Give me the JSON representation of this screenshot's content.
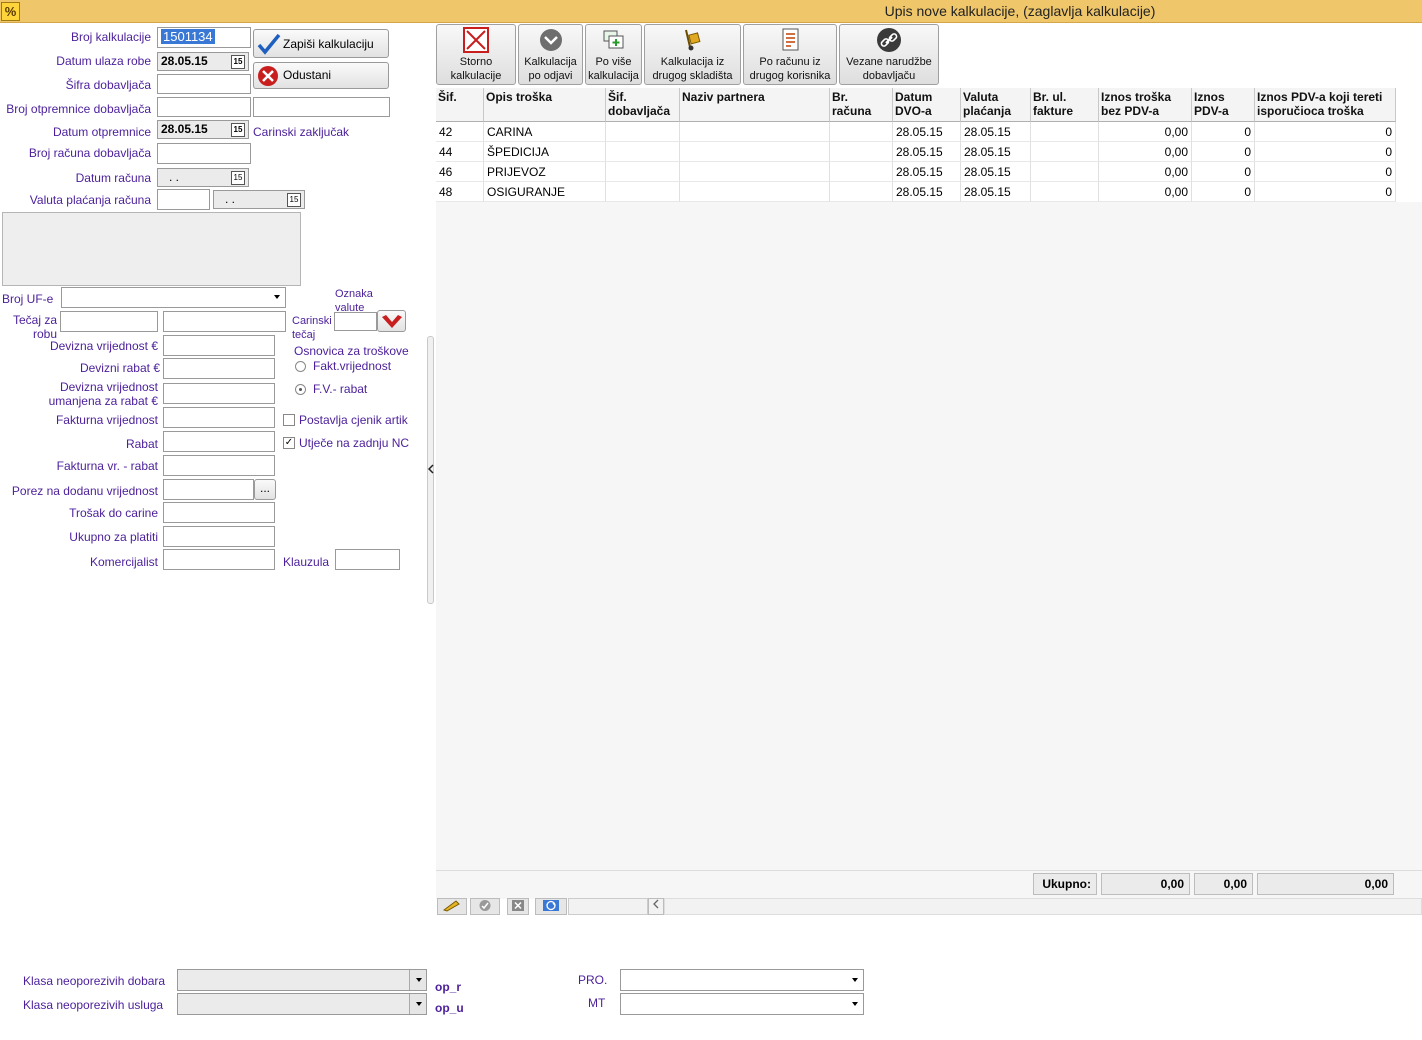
{
  "window": {
    "title": "Upis nove kalkulacije, (zaglavlja kalkulacije)",
    "icon": "%"
  },
  "form": {
    "broj_kalkulacije": {
      "label": "Broj kalkulacije",
      "value": "1501134"
    },
    "datum_ulaza": {
      "label": "Datum ulaza robe",
      "value": "28.05.15"
    },
    "sifra_dobavljaca": {
      "label": "Šifra dobavljača",
      "value": ""
    },
    "broj_otpremnice": {
      "label": "Broj otpremnice dobavljača",
      "value": ""
    },
    "datum_otpremnice": {
      "label": "Datum otpremnice",
      "value": "28.05.15"
    },
    "carinski_zakljucak": "Carinski zaključak",
    "broj_racuna": {
      "label": "Broj računa dobavljača",
      "value": ""
    },
    "datum_racuna": {
      "label": "Datum računa",
      "value": " .  ."
    },
    "valuta_placanja": {
      "label": "Valuta plaćanja računa",
      "value": " .  ."
    },
    "broj_ufe": {
      "label": "Broj UF-e"
    },
    "tecaj_za_robu": {
      "label_1": "Tečaj za",
      "label_2": "robu"
    },
    "oznaka_valute": {
      "label_1": "Oznaka",
      "label_2": "valute"
    },
    "carinski_tecaj": {
      "label_1": "Carinski",
      "label_2": "tečaj"
    },
    "devizna_vrijednost": "Devizna vrijednost €",
    "devizni_rabat": "Devizni rabat €",
    "devizna_umanjena": {
      "label_1": "Devizna vrijednost",
      "label_2": "umanjena za rabat €"
    },
    "fakturna_vrijednost": "Fakturna vrijednost",
    "rabat": "Rabat",
    "fakturna_minus_rabat": "Fakturna vr. - rabat",
    "pdv": "Porez na dodanu vrijednost",
    "pdv_button": "...",
    "trosak_do_carine": "Trošak do carine",
    "ukupno_za_platiti": "Ukupno za platiti",
    "komercijalist": "Komercijalist",
    "klauzula": "Klauzula",
    "osnovica_title": "Osnovica za troškove",
    "radio_fakt": "Fakt.vrijednost",
    "radio_fv": "F.V.- rabat",
    "chk_cjenik": "Postavlja cjenik artik",
    "chk_nc": "Utječe na zadnju NC",
    "chk_nc_mark": "✓"
  },
  "buttons": {
    "save": "Zapiši kalkulaciju",
    "cancel": "Odustani"
  },
  "toolbar": [
    {
      "l1": "Storno",
      "l2": "kalkulacije"
    },
    {
      "l1": "Kalkulacija",
      "l2": "po odjavi"
    },
    {
      "l1": "Po više",
      "l2": "kalkulacija"
    },
    {
      "l1": "Kalkulacija iz",
      "l2": "drugog skladišta"
    },
    {
      "l1": "Po računu iz",
      "l2": "drugog korisnika"
    },
    {
      "l1": "Vezane narudžbe",
      "l2": "dobavljaču"
    }
  ],
  "table": {
    "headers": [
      {
        "l1": "Šif.",
        "l2": ""
      },
      {
        "l1": "Opis troška",
        "l2": ""
      },
      {
        "l1": "Šif.",
        "l2": "dobavljača"
      },
      {
        "l1": "Naziv partnera",
        "l2": ""
      },
      {
        "l1": "Br. računa",
        "l2": ""
      },
      {
        "l1": "Datum",
        "l2": "DVO-a"
      },
      {
        "l1": "Valuta",
        "l2": "plaćanja"
      },
      {
        "l1": "Br. ul.",
        "l2": "fakture"
      },
      {
        "l1": "Iznos troška",
        "l2": "bez PDV-a"
      },
      {
        "l1": "Iznos",
        "l2": "PDV-a"
      },
      {
        "l1": "Iznos PDV-a koji tereti",
        "l2": "isporučioca troška"
      }
    ],
    "rows": [
      [
        "42",
        "CARINA",
        "",
        "",
        "",
        "28.05.15",
        "28.05.15",
        "",
        "0,00",
        "0",
        "0"
      ],
      [
        "44",
        "ŠPEDICIJA",
        "",
        "",
        "",
        "28.05.15",
        "28.05.15",
        "",
        "0,00",
        "0",
        "0"
      ],
      [
        "46",
        "PRIJEVOZ",
        "",
        "",
        "",
        "28.05.15",
        "28.05.15",
        "",
        "0,00",
        "0",
        "0"
      ],
      [
        "48",
        "OSIGURANJE",
        "",
        "",
        "",
        "28.05.15",
        "28.05.15",
        "",
        "0,00",
        "0",
        "0"
      ]
    ],
    "total_label": "Ukupno:",
    "totals": [
      "0,00",
      "0,00",
      "0,00"
    ]
  },
  "bottom": {
    "klasa_dobara": "Klasa neoporezivih dobara",
    "klasa_usluga": "Klasa neoporezivih usluga",
    "op_r": "op_r",
    "op_u": "op_u",
    "pro": "PRO.",
    "mt": "MT"
  },
  "colors": {
    "titlebar": "#f0c66a",
    "label": "#4b1f9a",
    "accent_red": "#c81e1e",
    "accent_blue": "#1f5fbf"
  }
}
